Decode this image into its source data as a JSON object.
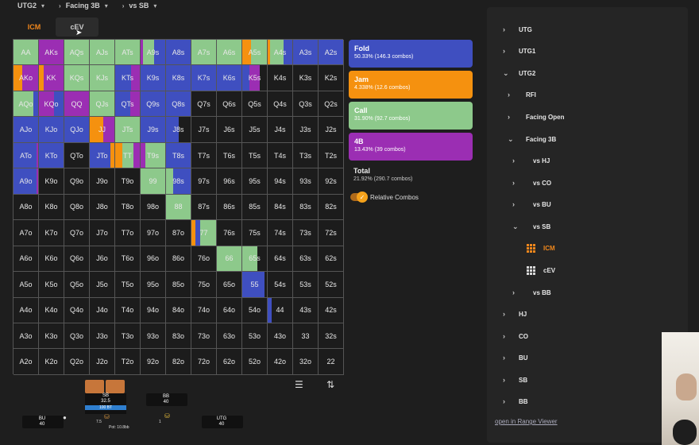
{
  "breadcrumb": [
    "UTG2",
    "Facing 3B",
    "vs SB"
  ],
  "tabs": [
    {
      "label": "ICM"
    },
    {
      "label": "cEV"
    }
  ],
  "colors": {
    "fold": "#3f4fc0",
    "jam": "#f5910f",
    "call": "#8dc98b",
    "fourb": "#9b2eb3",
    "empty": "#1c1c1c"
  },
  "legend": {
    "fold": {
      "title": "Fold",
      "sub": "50.33% (146.3 combos)"
    },
    "jam": {
      "title": "Jam",
      "sub": "4.338% (12.6 combos)"
    },
    "call": {
      "title": "Call",
      "sub": "31.90% (92.7 combos)"
    },
    "fourb": {
      "title": "4B",
      "sub": "13.43% (39 combos)"
    },
    "total": {
      "title": "Total",
      "sub": "21.92% (290.7 combos)"
    },
    "toggle_label": "Relative Combos"
  },
  "grid_labels": [
    [
      "AA",
      "AKs",
      "AQs",
      "AJs",
      "ATs",
      "A9s",
      "A8s",
      "A7s",
      "A6s",
      "A5s",
      "A4s",
      "A3s",
      "A2s"
    ],
    [
      "AKo",
      "KK",
      "KQs",
      "KJs",
      "KTs",
      "K9s",
      "K8s",
      "K7s",
      "K6s",
      "K5s",
      "K4s",
      "K3s",
      "K2s"
    ],
    [
      "AQo",
      "KQo",
      "QQ",
      "QJs",
      "QTs",
      "Q9s",
      "Q8s",
      "Q7s",
      "Q6s",
      "Q5s",
      "Q4s",
      "Q3s",
      "Q2s"
    ],
    [
      "AJo",
      "KJo",
      "QJo",
      "JJ",
      "JTs",
      "J9s",
      "J8s",
      "J7s",
      "J6s",
      "J5s",
      "J4s",
      "J3s",
      "J2s"
    ],
    [
      "ATo",
      "KTo",
      "QTo",
      "JTo",
      "TT",
      "T9s",
      "T8s",
      "T7s",
      "T6s",
      "T5s",
      "T4s",
      "T3s",
      "T2s"
    ],
    [
      "A9o",
      "K9o",
      "Q9o",
      "J9o",
      "T9o",
      "99",
      "98s",
      "97s",
      "96s",
      "95s",
      "94s",
      "93s",
      "92s"
    ],
    [
      "A8o",
      "K8o",
      "Q8o",
      "J8o",
      "T8o",
      "98o",
      "88",
      "87s",
      "86s",
      "85s",
      "84s",
      "83s",
      "82s"
    ],
    [
      "A7o",
      "K7o",
      "Q7o",
      "J7o",
      "T7o",
      "97o",
      "87o",
      "77",
      "76s",
      "75s",
      "74s",
      "73s",
      "72s"
    ],
    [
      "A6o",
      "K6o",
      "Q6o",
      "J6o",
      "T6o",
      "96o",
      "86o",
      "76o",
      "66",
      "65s",
      "64s",
      "63s",
      "62s"
    ],
    [
      "A5o",
      "K5o",
      "Q5o",
      "J5o",
      "T5o",
      "95o",
      "85o",
      "75o",
      "65o",
      "55",
      "54s",
      "53s",
      "52s"
    ],
    [
      "A4o",
      "K4o",
      "Q4o",
      "J4o",
      "T4o",
      "94o",
      "84o",
      "74o",
      "64o",
      "54o",
      "44",
      "43s",
      "42s"
    ],
    [
      "A3o",
      "K3o",
      "Q3o",
      "J3o",
      "T3o",
      "93o",
      "83o",
      "73o",
      "63o",
      "53o",
      "43o",
      "33",
      "32s"
    ],
    [
      "A2o",
      "K2o",
      "Q2o",
      "J2o",
      "T2o",
      "92o",
      "82o",
      "72o",
      "62o",
      "52o",
      "42o",
      "32o",
      "22"
    ]
  ],
  "grid_mix": {
    "0-0": [
      [
        "call",
        1
      ]
    ],
    "0-1": [
      [
        "fourb",
        1
      ]
    ],
    "0-2": [
      [
        "call",
        1
      ]
    ],
    "0-3": [
      [
        "call",
        1
      ]
    ],
    "0-4": [
      [
        "call",
        1
      ]
    ],
    "0-5": [
      [
        "fourb",
        0.1
      ],
      [
        "call",
        0.45
      ],
      [
        "fold",
        0.45
      ]
    ],
    "0-6": [
      [
        "fold",
        1
      ]
    ],
    "0-7": [
      [
        "call",
        1
      ]
    ],
    "0-8": [
      [
        "call",
        1
      ]
    ],
    "0-9": [
      [
        "jam",
        0.35
      ],
      [
        "call",
        0.65
      ]
    ],
    "0-10": [
      [
        "jam",
        0.1
      ],
      [
        "call",
        0.55
      ],
      [
        "fold",
        0.35
      ]
    ],
    "0-11": [
      [
        "fold",
        1
      ]
    ],
    "0-12": [
      [
        "fold",
        1
      ]
    ],
    "1-0": [
      [
        "jam",
        0.35
      ],
      [
        "fourb",
        0.65
      ]
    ],
    "1-1": [
      [
        "jam",
        0.2
      ],
      [
        "fourb",
        0.8
      ]
    ],
    "1-2": [
      [
        "call",
        1
      ]
    ],
    "1-3": [
      [
        "call",
        1
      ]
    ],
    "1-4": [
      [
        "fold",
        0.65
      ],
      [
        "fourb",
        0.35
      ]
    ],
    "1-5": [
      [
        "fold",
        1
      ]
    ],
    "1-6": [
      [
        "fold",
        1
      ]
    ],
    "1-7": [
      [
        "fold",
        1
      ]
    ],
    "1-8": [
      [
        "fold",
        1
      ]
    ],
    "1-9": [
      [
        "fold",
        0.3
      ],
      [
        "fourb",
        0.4
      ],
      [
        "empty",
        0.3
      ]
    ],
    "1-10": [
      [
        "empty",
        1
      ]
    ],
    "1-11": [
      [
        "empty",
        1
      ]
    ],
    "1-12": [
      [
        "empty",
        1
      ]
    ],
    "2-0": [
      [
        "call",
        0.8
      ],
      [
        "fold",
        0.2
      ]
    ],
    "2-1": [
      [
        "fourb",
        0.6
      ],
      [
        "fold",
        0.4
      ]
    ],
    "2-2": [
      [
        "fourb",
        1
      ]
    ],
    "2-3": [
      [
        "call",
        1
      ]
    ],
    "2-4": [
      [
        "fold",
        0.6
      ],
      [
        "fourb",
        0.4
      ]
    ],
    "2-5": [
      [
        "fold",
        1
      ]
    ],
    "2-6": [
      [
        "fold",
        1
      ]
    ],
    "2-7": [
      [
        "empty",
        1
      ]
    ],
    "2-8": [
      [
        "empty",
        1
      ]
    ],
    "2-9": [
      [
        "empty",
        1
      ]
    ],
    "2-10": [
      [
        "empty",
        1
      ]
    ],
    "2-11": [
      [
        "empty",
        1
      ]
    ],
    "2-12": [
      [
        "empty",
        1
      ]
    ],
    "3-0": [
      [
        "fold",
        1
      ]
    ],
    "3-1": [
      [
        "fold",
        1
      ]
    ],
    "3-2": [
      [
        "fold",
        1
      ]
    ],
    "3-3": [
      [
        "jam",
        0.55
      ],
      [
        "fourb",
        0.45
      ]
    ],
    "3-4": [
      [
        "call",
        1
      ]
    ],
    "3-5": [
      [
        "fold",
        1
      ]
    ],
    "3-6": [
      [
        "fold",
        0.5
      ],
      [
        "empty",
        0.5
      ]
    ],
    "3-7": [
      [
        "empty",
        1
      ]
    ],
    "3-8": [
      [
        "empty",
        1
      ]
    ],
    "3-9": [
      [
        "empty",
        1
      ]
    ],
    "3-10": [
      [
        "empty",
        1
      ]
    ],
    "3-11": [
      [
        "empty",
        1
      ]
    ],
    "3-12": [
      [
        "empty",
        1
      ]
    ],
    "4-0": [
      [
        "fold",
        0.95
      ],
      [
        "fourb",
        0.05
      ]
    ],
    "4-1": [
      [
        "fold",
        1
      ]
    ],
    "4-2": [
      [
        "empty",
        1
      ]
    ],
    "4-3": [
      [
        "fold",
        0.85
      ],
      [
        "jam",
        0.15
      ]
    ],
    "4-4": [
      [
        "jam",
        0.3
      ],
      [
        "call",
        0.45
      ],
      [
        "fourb",
        0.25
      ]
    ],
    "4-5": [
      [
        "fourb",
        0.2
      ],
      [
        "call",
        0.8
      ]
    ],
    "4-6": [
      [
        "fold",
        1
      ]
    ],
    "4-7": [
      [
        "empty",
        1
      ]
    ],
    "4-8": [
      [
        "empty",
        1
      ]
    ],
    "4-9": [
      [
        "empty",
        1
      ]
    ],
    "4-10": [
      [
        "empty",
        1
      ]
    ],
    "4-11": [
      [
        "empty",
        1
      ]
    ],
    "4-12": [
      [
        "empty",
        1
      ]
    ],
    "5-0": [
      [
        "fold",
        0.95
      ],
      [
        "fourb",
        0.05
      ]
    ],
    "5-1": [
      [
        "empty",
        1
      ]
    ],
    "5-2": [
      [
        "empty",
        1
      ]
    ],
    "5-3": [
      [
        "empty",
        1
      ]
    ],
    "5-4": [
      [
        "empty",
        1
      ]
    ],
    "5-5": [
      [
        "call",
        1
      ]
    ],
    "5-6": [
      [
        "call",
        0.3
      ],
      [
        "fold",
        0.7
      ]
    ],
    "5-7": [
      [
        "empty",
        1
      ]
    ],
    "5-8": [
      [
        "empty",
        1
      ]
    ],
    "5-9": [
      [
        "empty",
        1
      ]
    ],
    "5-10": [
      [
        "empty",
        1
      ]
    ],
    "5-11": [
      [
        "empty",
        1
      ]
    ],
    "5-12": [
      [
        "empty",
        1
      ]
    ],
    "6-0": [
      [
        "empty",
        1
      ]
    ],
    "6-1": [
      [
        "empty",
        1
      ]
    ],
    "6-2": [
      [
        "empty",
        1
      ]
    ],
    "6-3": [
      [
        "empty",
        1
      ]
    ],
    "6-4": [
      [
        "empty",
        1
      ]
    ],
    "6-5": [
      [
        "empty",
        1
      ]
    ],
    "6-6": [
      [
        "call",
        1
      ]
    ],
    "6-7": [
      [
        "empty",
        1
      ]
    ],
    "6-8": [
      [
        "empty",
        1
      ]
    ],
    "6-9": [
      [
        "empty",
        1
      ]
    ],
    "6-10": [
      [
        "empty",
        1
      ]
    ],
    "6-11": [
      [
        "empty",
        1
      ]
    ],
    "6-12": [
      [
        "empty",
        1
      ]
    ],
    "7-0": [
      [
        "empty",
        1
      ]
    ],
    "7-1": [
      [
        "empty",
        1
      ]
    ],
    "7-2": [
      [
        "empty",
        1
      ]
    ],
    "7-3": [
      [
        "empty",
        1
      ]
    ],
    "7-4": [
      [
        "empty",
        1
      ]
    ],
    "7-5": [
      [
        "empty",
        1
      ]
    ],
    "7-6": [
      [
        "empty",
        1
      ]
    ],
    "7-7": [
      [
        "jam",
        0.15
      ],
      [
        "fold",
        0.2
      ],
      [
        "call",
        0.65
      ]
    ],
    "7-8": [
      [
        "empty",
        1
      ]
    ],
    "7-9": [
      [
        "empty",
        1
      ]
    ],
    "7-10": [
      [
        "empty",
        1
      ]
    ],
    "7-11": [
      [
        "empty",
        1
      ]
    ],
    "7-12": [
      [
        "empty",
        1
      ]
    ],
    "8-0": [
      [
        "empty",
        1
      ]
    ],
    "8-1": [
      [
        "empty",
        1
      ]
    ],
    "8-2": [
      [
        "empty",
        1
      ]
    ],
    "8-3": [
      [
        "empty",
        1
      ]
    ],
    "8-4": [
      [
        "empty",
        1
      ]
    ],
    "8-5": [
      [
        "empty",
        1
      ]
    ],
    "8-6": [
      [
        "empty",
        1
      ]
    ],
    "8-7": [
      [
        "empty",
        1
      ]
    ],
    "8-8": [
      [
        "call",
        1
      ]
    ],
    "8-9": [
      [
        "call",
        0.6
      ],
      [
        "empty",
        0.4
      ]
    ],
    "8-10": [
      [
        "empty",
        1
      ]
    ],
    "8-11": [
      [
        "empty",
        1
      ]
    ],
    "8-12": [
      [
        "empty",
        1
      ]
    ],
    "9-0": [
      [
        "empty",
        1
      ]
    ],
    "9-1": [
      [
        "empty",
        1
      ]
    ],
    "9-2": [
      [
        "empty",
        1
      ]
    ],
    "9-3": [
      [
        "empty",
        1
      ]
    ],
    "9-4": [
      [
        "empty",
        1
      ]
    ],
    "9-5": [
      [
        "empty",
        1
      ]
    ],
    "9-6": [
      [
        "empty",
        1
      ]
    ],
    "9-7": [
      [
        "empty",
        1
      ]
    ],
    "9-8": [
      [
        "empty",
        1
      ]
    ],
    "9-9": [
      [
        "fold",
        0.9
      ],
      [
        "empty",
        0.1
      ]
    ],
    "9-10": [
      [
        "empty",
        1
      ]
    ],
    "9-11": [
      [
        "empty",
        1
      ]
    ],
    "9-12": [
      [
        "empty",
        1
      ]
    ],
    "10-0": [
      [
        "empty",
        1
      ]
    ],
    "10-1": [
      [
        "empty",
        1
      ]
    ],
    "10-2": [
      [
        "empty",
        1
      ]
    ],
    "10-3": [
      [
        "empty",
        1
      ]
    ],
    "10-4": [
      [
        "empty",
        1
      ]
    ],
    "10-5": [
      [
        "empty",
        1
      ]
    ],
    "10-6": [
      [
        "empty",
        1
      ]
    ],
    "10-7": [
      [
        "empty",
        1
      ]
    ],
    "10-8": [
      [
        "empty",
        1
      ]
    ],
    "10-9": [
      [
        "empty",
        1
      ]
    ],
    "10-10": [
      [
        "fold",
        0.15
      ],
      [
        "empty",
        0.85
      ]
    ],
    "10-11": [
      [
        "empty",
        1
      ]
    ],
    "10-12": [
      [
        "empty",
        1
      ]
    ]
  },
  "controls": {
    "list_icon": "☰",
    "sort_icon": "⇅"
  },
  "table": {
    "sb": {
      "name": "SB",
      "stack": "32.5",
      "bar": "100 BT"
    },
    "bb": {
      "name": "BB",
      "stack": "40"
    },
    "bu": {
      "name": "BU",
      "stack": "40"
    },
    "utg": {
      "name": "UTG",
      "stack": "40"
    },
    "bet_sb": "7.5",
    "pot": "Pot: 10.8bb",
    "bet_bb": "1"
  },
  "tree": [
    {
      "label": "UTG",
      "chev": "›",
      "indent": 0
    },
    {
      "label": "UTG1",
      "chev": "›",
      "indent": 0
    },
    {
      "label": "UTG2",
      "chev": "⌄",
      "indent": 0
    },
    {
      "label": "RFI",
      "chev": "›",
      "indent": 1
    },
    {
      "label": "Facing Open",
      "chev": "›",
      "indent": 1
    },
    {
      "label": "Facing 3B",
      "chev": "⌄",
      "indent": 1
    },
    {
      "label": "vs HJ",
      "chev": "›",
      "indent": 2
    },
    {
      "label": "vs CO",
      "chev": "›",
      "indent": 2
    },
    {
      "label": "vs BU",
      "chev": "›",
      "indent": 2
    },
    {
      "label": "vs SB",
      "chev": "⌄",
      "indent": 2
    },
    {
      "label": "ICM",
      "chev": "",
      "indent": 3,
      "icon": "o",
      "selected": true
    },
    {
      "label": "cEV",
      "chev": "",
      "indent": 3,
      "icon": "w"
    },
    {
      "label": "vs BB",
      "chev": "›",
      "indent": 2
    },
    {
      "label": "HJ",
      "chev": "›",
      "indent": 0
    },
    {
      "label": "CO",
      "chev": "›",
      "indent": 0
    },
    {
      "label": "BU",
      "chev": "›",
      "indent": 0
    },
    {
      "label": "SB",
      "chev": "›",
      "indent": 0
    },
    {
      "label": "BB",
      "chev": "›",
      "indent": 0
    }
  ],
  "link_label": "open in Range Viewer"
}
